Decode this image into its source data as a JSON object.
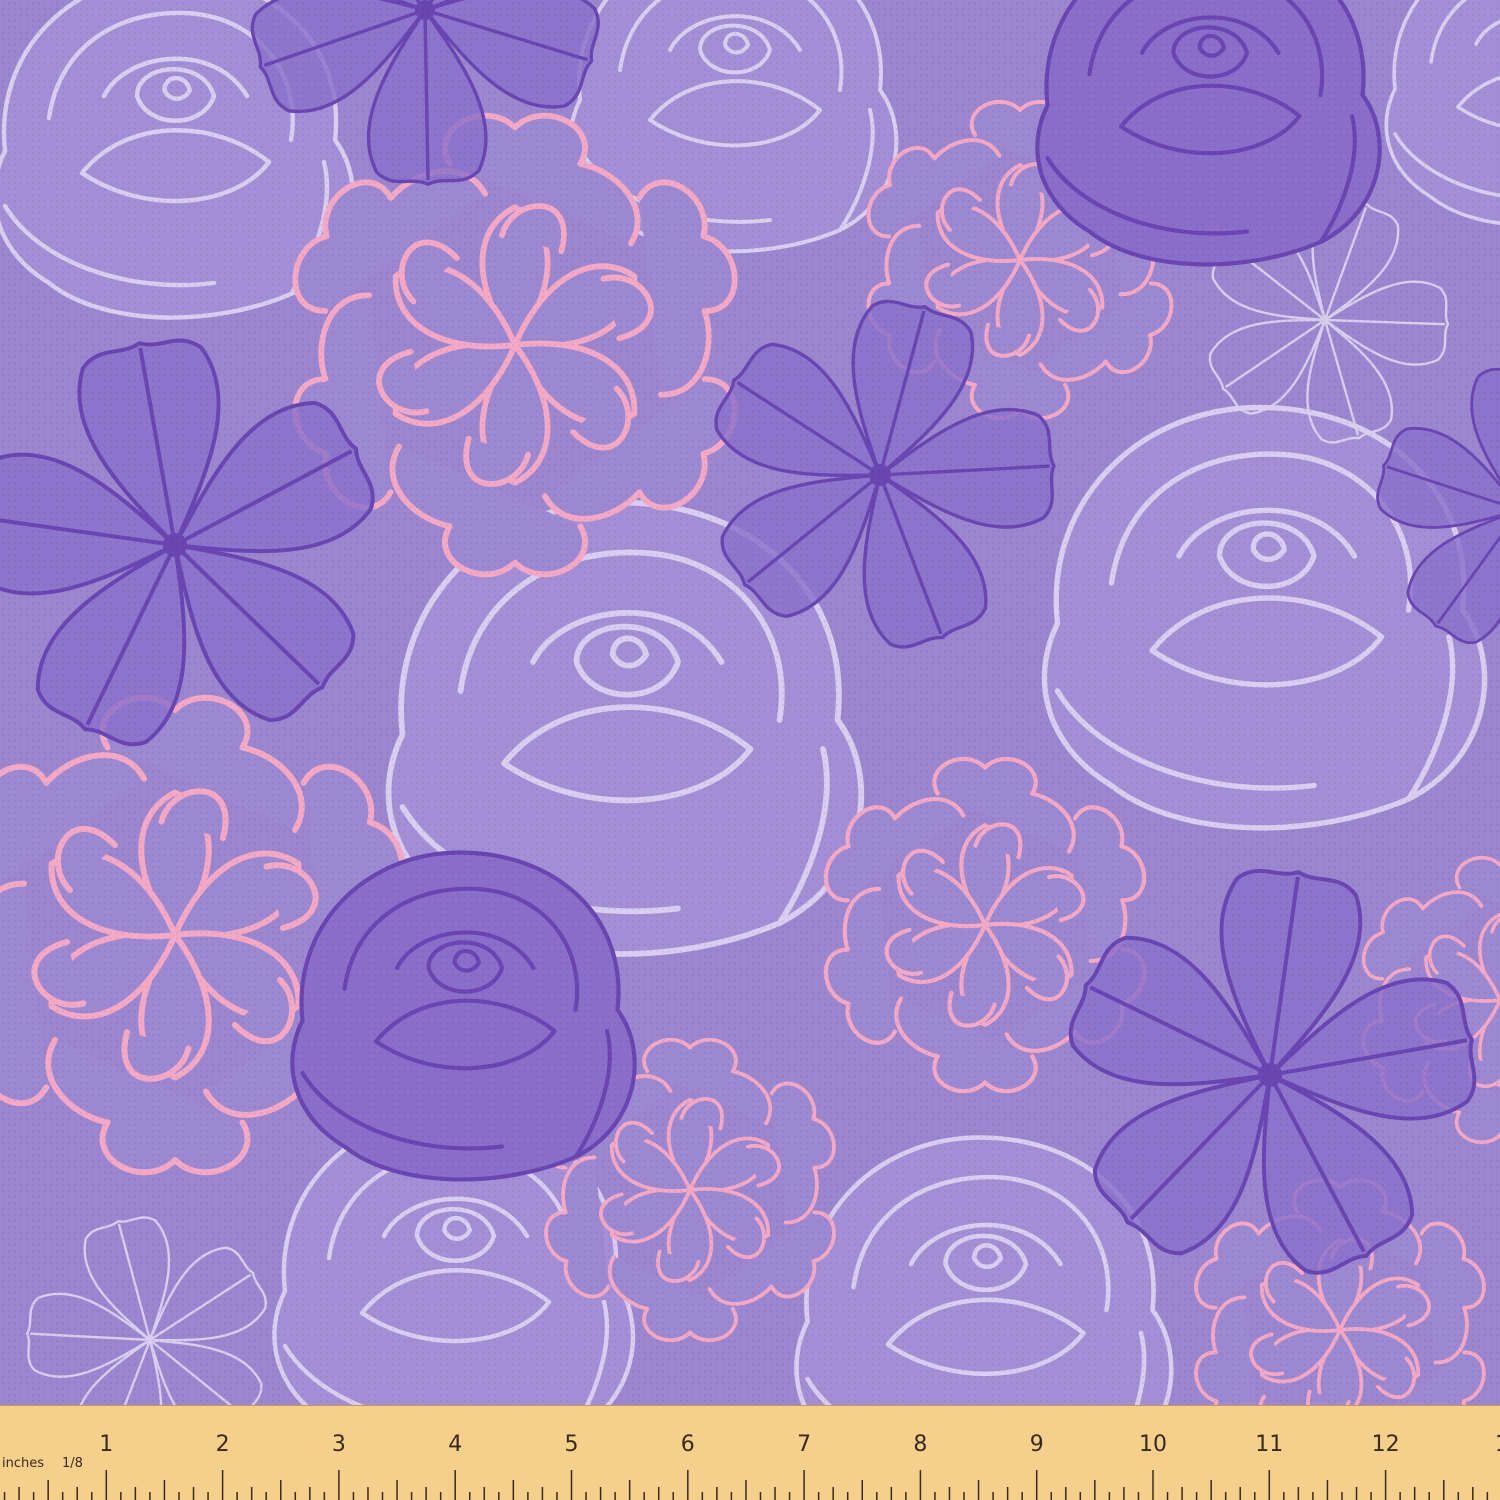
{
  "fabric": {
    "background_color": "#9b86cf",
    "colors": {
      "rose_outline_light": "#d9cdf0",
      "pink_outline": "#f3a9c6",
      "violet_outline": "#6a46b3",
      "violet_fill": "#8a6fca"
    }
  },
  "ruler": {
    "background_color": "#f5cf8c",
    "unit_label": "inches",
    "fraction_label": "1/8",
    "numbers": [
      "1",
      "2",
      "3",
      "4",
      "5",
      "6",
      "7",
      "8",
      "9",
      "10",
      "11",
      "12",
      "1"
    ]
  }
}
